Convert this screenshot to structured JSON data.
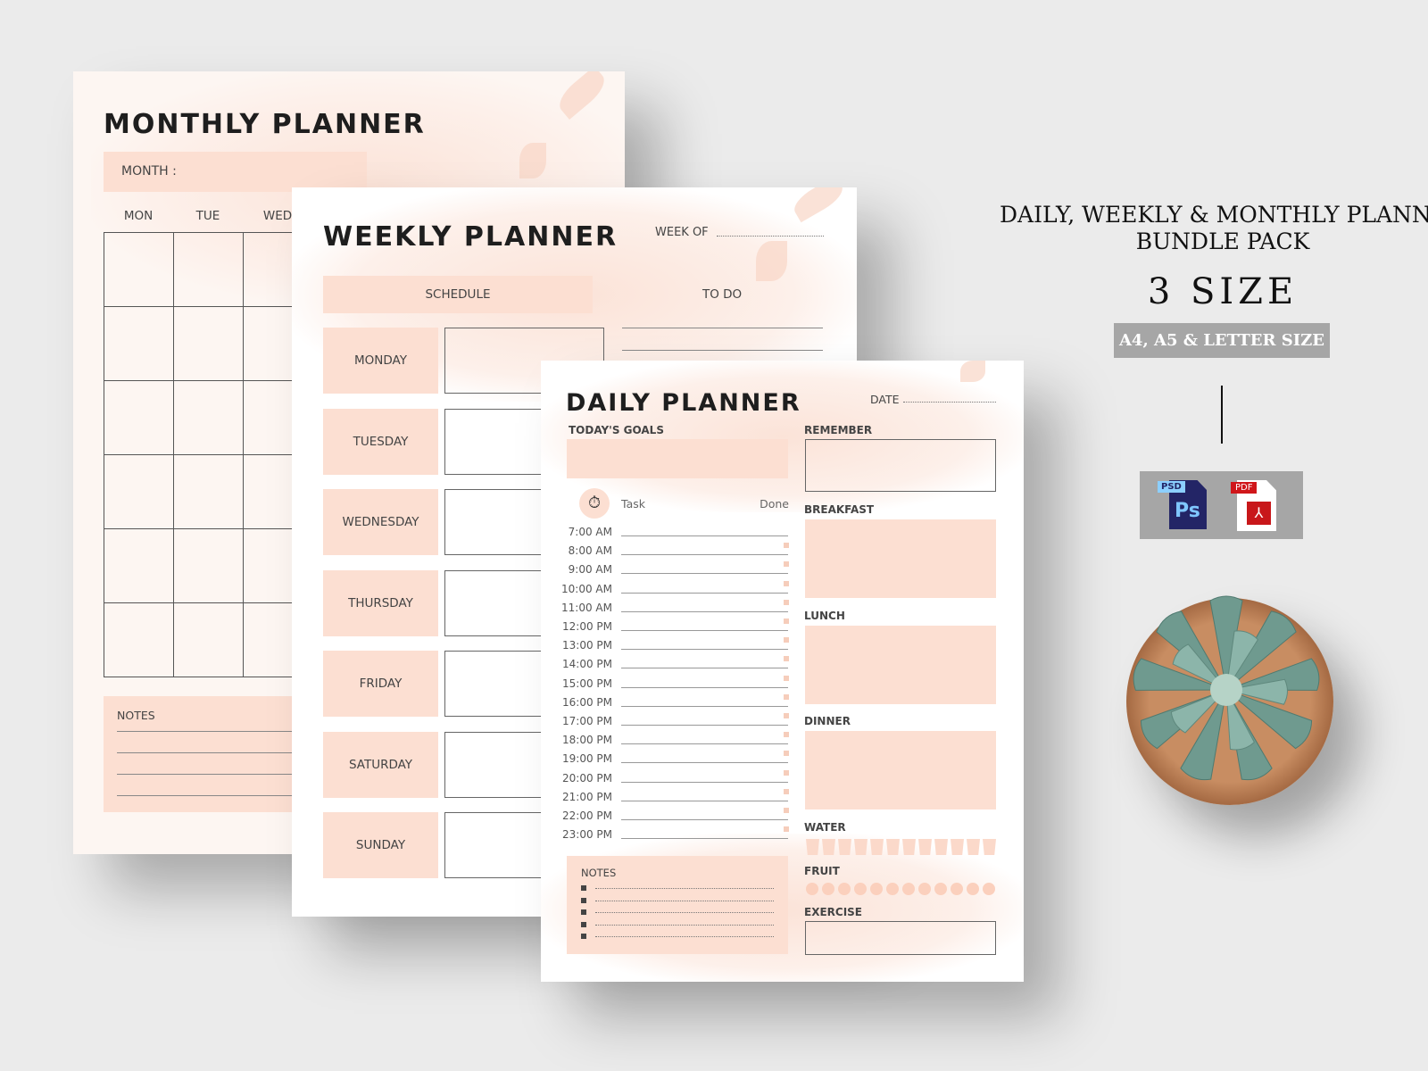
{
  "colors": {
    "background": "#ebebeb",
    "peach": "#fcdfd2",
    "badge": "#a6a6a6"
  },
  "monthly": {
    "title": "MONTHLY PLANNER",
    "month_label": "MONTH :",
    "days": [
      "MON",
      "TUE",
      "WED"
    ],
    "notes_label": "NOTES"
  },
  "weekly": {
    "title": "WEEKLY PLANNER",
    "week_of_label": "WEEK OF",
    "schedule_label": "SCHEDULE",
    "todo_label": "TO DO",
    "days": [
      "MONDAY",
      "TUESDAY",
      "WEDNESDAY",
      "THURSDAY",
      "FRIDAY",
      "SATURDAY",
      "SUNDAY"
    ]
  },
  "daily": {
    "title": "DAILY PLANNER",
    "date_label": "DATE",
    "goals_label": "TODAY'S GOALS",
    "remember_label": "REMEMBER",
    "task_label": "Task",
    "done_label": "Done",
    "times": [
      "7:00 AM",
      "8:00 AM",
      "9:00 AM",
      "10:00 AM",
      "11:00 AM",
      "12:00 PM",
      "13:00 PM",
      "14:00 PM",
      "15:00 PM",
      "16:00 PM",
      "17:00 PM",
      "18:00 PM",
      "19:00 PM",
      "20:00 PM",
      "21:00 PM",
      "22:00 PM",
      "23:00 PM"
    ],
    "breakfast_label": "BREAKFAST",
    "lunch_label": "LUNCH",
    "dinner_label": "DINNER",
    "water_label": "WATER",
    "fruit_label": "FRUIT",
    "exercise_label": "EXERCISE",
    "notes_label": "NOTES"
  },
  "promo": {
    "headline_line1": "DAILY, WEEKLY & MONTHLY PLANNER",
    "headline_line2": "BUNDLE PACK",
    "size_count": "3 SIZE",
    "sizes_badge": "A4, A5 & LETTER SIZE",
    "formats": [
      {
        "label": "PSD",
        "glyph": "Ps",
        "icon": "photoshop-file-icon"
      },
      {
        "label": "PDF",
        "glyph": "",
        "icon": "pdf-file-icon"
      }
    ]
  }
}
